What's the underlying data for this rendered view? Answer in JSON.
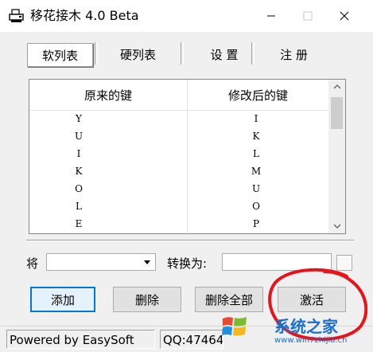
{
  "window": {
    "title": "移花接木 4.0 Beta",
    "app_icon": "printer-icon",
    "controls": {
      "minimize": "minimize-icon",
      "maximize": "maximize-icon",
      "close": "close-icon"
    }
  },
  "tabs": [
    {
      "label": "软列表",
      "active": true
    },
    {
      "label": "硬列表",
      "active": false
    },
    {
      "label": "设 置",
      "active": false
    },
    {
      "label": "注 册",
      "active": false
    }
  ],
  "list": {
    "columns": [
      "原来的键",
      "修改后的键"
    ],
    "rows": [
      [
        "Y",
        "I"
      ],
      [
        "U",
        "K"
      ],
      [
        "I",
        "L"
      ],
      [
        "K",
        "M"
      ],
      [
        "O",
        "U"
      ],
      [
        "L",
        "O"
      ],
      [
        "E",
        "P"
      ]
    ]
  },
  "mapping": {
    "from_label": "将",
    "from_value": "",
    "to_label": "转换为:",
    "to_value": ""
  },
  "buttons": {
    "add": "添加",
    "delete": "删除",
    "delete_all": "删除全部",
    "activate": "激活"
  },
  "status": {
    "powered": "Powered by EasySoft",
    "qq": "QQ:47464"
  },
  "watermark": {
    "brand": "系统之家",
    "url": "www.win7zhijia.cn"
  },
  "colors": {
    "default_button_border": "#0078d7",
    "annotation_red": "#e8141c"
  }
}
